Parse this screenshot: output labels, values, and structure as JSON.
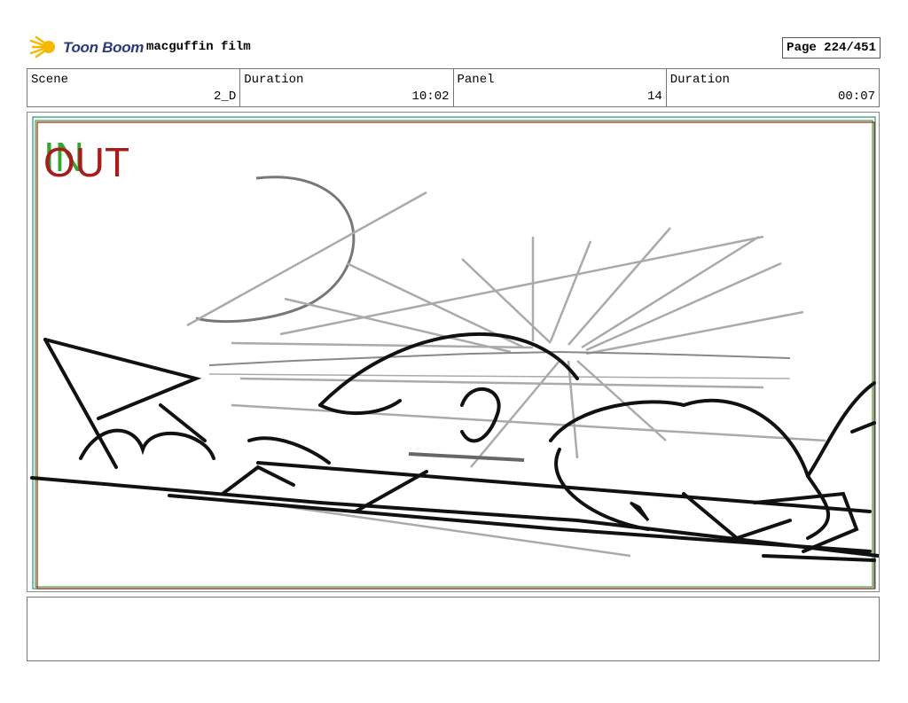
{
  "header": {
    "logo_text": "Toon Boom",
    "film_title": "macguffin film",
    "page_label": "Page 224/451"
  },
  "info": {
    "scene_label": "Scene",
    "scene_value": "2_D",
    "scene_duration_label": "Duration",
    "scene_duration_value": "10:02",
    "panel_label": "Panel",
    "panel_value": "14",
    "panel_duration_label": "Duration",
    "panel_duration_value": "00:07"
  },
  "panel": {
    "in_mark": "IN",
    "out_mark": "OUT",
    "in_color": "#2ea82e",
    "out_color": "#a81c1c"
  },
  "notes": {
    "text": ""
  }
}
